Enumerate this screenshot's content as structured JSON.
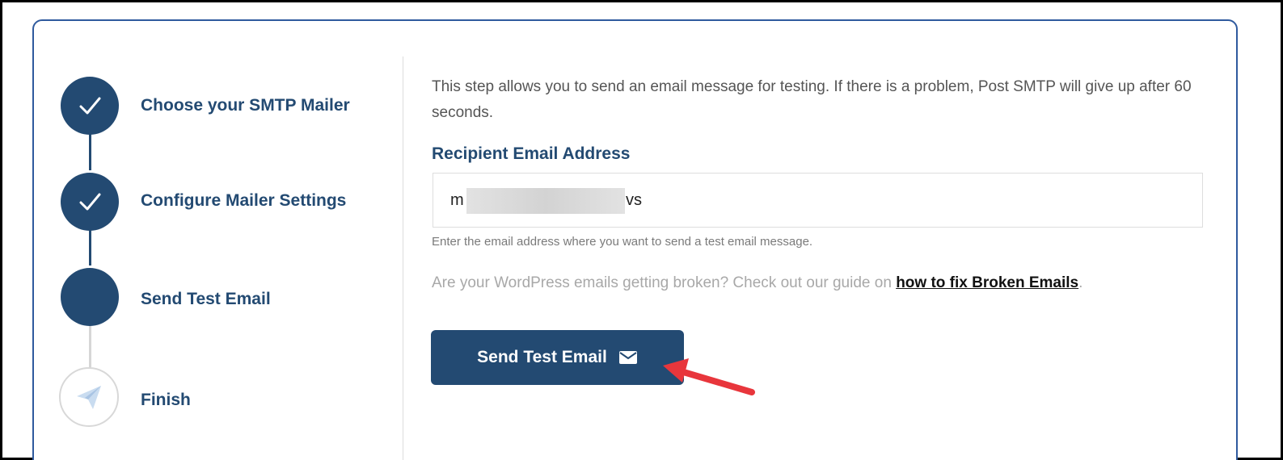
{
  "steps": [
    {
      "label": "Choose your SMTP Mailer",
      "status": "completed",
      "icon": "check-icon"
    },
    {
      "label": "Configure Mailer Settings",
      "status": "completed",
      "icon": "check-icon"
    },
    {
      "label": "Send Test Email",
      "status": "current",
      "icon": "none"
    },
    {
      "label": "Finish",
      "status": "pending",
      "icon": "paper-plane-icon"
    }
  ],
  "content": {
    "intro": "This step allows you to send an email message for testing. If there is a problem, Post SMTP will give up after 60 seconds.",
    "recipient_label": "Recipient Email Address",
    "email_value_start": "m",
    "email_value_end": "vs",
    "help_text": "Enter the email address where you want to send a test email message.",
    "guide_text": "Are your WordPress emails getting broken? Check out our guide on ",
    "guide_link": "how to fix Broken Emails",
    "guide_suffix": "."
  },
  "send_button": {
    "label": "Send Test Email",
    "icon": "envelope-icon"
  },
  "colors": {
    "primary": "#234a72",
    "frame_border": "#2f5a9e",
    "arrow": "#e8363c",
    "muted_text": "#a8a8a8"
  }
}
